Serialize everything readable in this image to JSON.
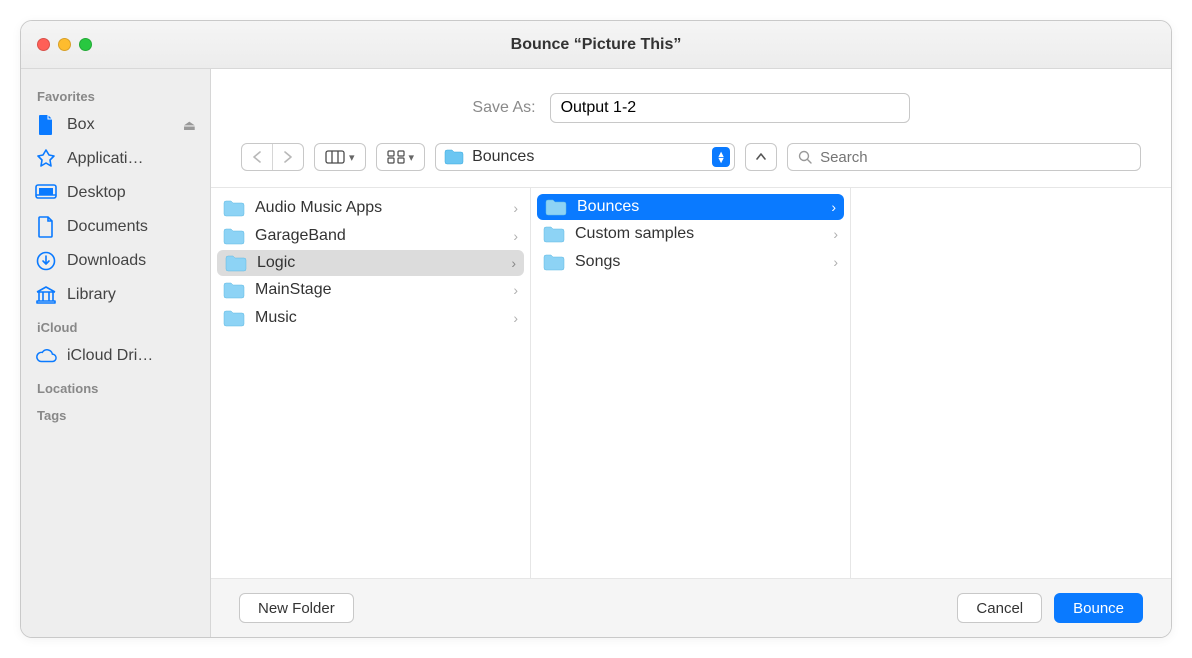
{
  "window_title": "Bounce “Picture This”",
  "save_as": {
    "label": "Save As:",
    "value": "Output 1-2"
  },
  "sidebar": {
    "sections": [
      {
        "title": "Favorites",
        "items": [
          {
            "label": "Box",
            "icon": "document",
            "eject": true
          },
          {
            "label": "Applicati…",
            "icon": "app"
          },
          {
            "label": "Desktop",
            "icon": "desktop"
          },
          {
            "label": "Documents",
            "icon": "documents"
          },
          {
            "label": "Downloads",
            "icon": "downloads"
          },
          {
            "label": "Library",
            "icon": "library"
          }
        ]
      },
      {
        "title": "iCloud",
        "items": [
          {
            "label": "iCloud Dri…",
            "icon": "cloud"
          }
        ]
      },
      {
        "title": "Locations",
        "items": []
      },
      {
        "title": "Tags",
        "items": []
      }
    ]
  },
  "path": {
    "label": "Bounces",
    "icon": "folder"
  },
  "search": {
    "placeholder": "Search"
  },
  "columns": [
    [
      {
        "label": "Audio Music Apps",
        "selected": false
      },
      {
        "label": "GarageBand",
        "selected": false
      },
      {
        "label": "Logic",
        "selected": "path"
      },
      {
        "label": "MainStage",
        "selected": false
      },
      {
        "label": "Music",
        "selected": false
      }
    ],
    [
      {
        "label": "Bounces",
        "selected": "active"
      },
      {
        "label": "Custom samples",
        "selected": false
      },
      {
        "label": "Songs",
        "selected": false
      }
    ]
  ],
  "buttons": {
    "new_folder": "New Folder",
    "cancel": "Cancel",
    "bounce": "Bounce"
  }
}
